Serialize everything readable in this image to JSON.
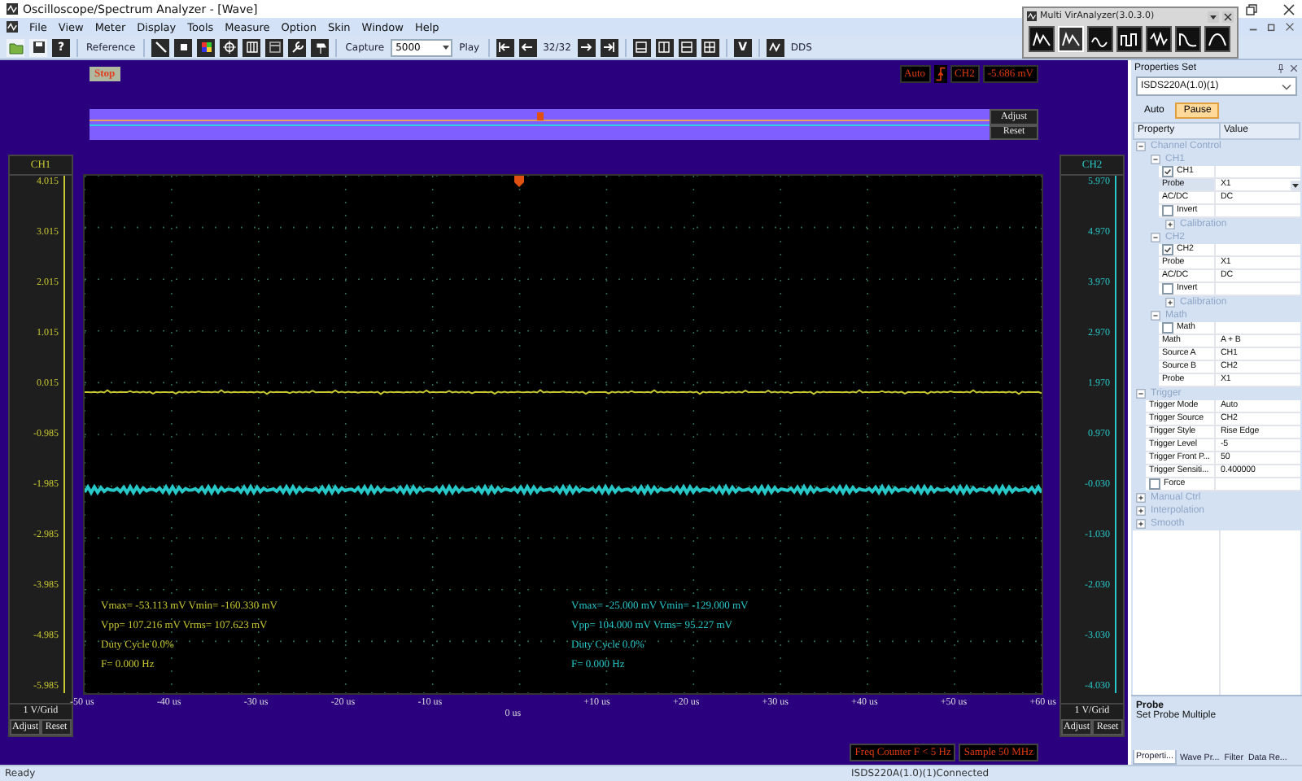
{
  "window": {
    "title": "Oscilloscope/Spectrum Analyzer - [Wave]"
  },
  "menu": [
    "File",
    "View",
    "Meter",
    "Display",
    "Tools",
    "Measure",
    "Option",
    "Skin",
    "Window",
    "Help"
  ],
  "toolbar": {
    "help": "?",
    "reference": "Reference",
    "capture_label": "Capture",
    "capture_value": "5000",
    "play": "Play",
    "frame": "32/32",
    "v": "V",
    "dds": "DDS"
  },
  "analyzer_window": {
    "title": "Multi VirAnalyzer(3.0.3.0)",
    "tools": [
      {
        "selected": false
      },
      {
        "selected": true
      },
      {
        "selected": false
      },
      {
        "selected": false
      },
      {
        "selected": false
      },
      {
        "selected": false
      },
      {
        "selected": false
      }
    ]
  },
  "scope": {
    "stop": "Stop",
    "trigger": {
      "mode": "Auto",
      "source": "CH2",
      "level": "-5.686 mV"
    },
    "overview": {
      "adjust": "Adjust",
      "reset": "Reset"
    },
    "channels": [
      {
        "name": "CH1",
        "color": "#c8c832",
        "ticks": [
          "4.015",
          "3.015",
          "2.015",
          "1.015",
          "0.015",
          "-0.985",
          "-1.985",
          "-2.985",
          "-3.985",
          "-4.985",
          "-5.985"
        ],
        "scale": "1 V/Grid",
        "adjust": "Adjust",
        "reset": "Reset",
        "measurements": [
          "Vmax= -53.113 mV Vmin= -160.330 mV",
          "Vpp= 107.216 mV Vrms= 107.623 mV",
          "Duty Cycle 0.0%",
          "F= 0.000 Hz"
        ]
      },
      {
        "name": "CH2",
        "color": "#28c8c8",
        "ticks": [
          "5.970",
          "4.970",
          "3.970",
          "2.970",
          "1.970",
          "0.970",
          "-0.030",
          "-1.030",
          "-2.030",
          "-3.030",
          "-4.030"
        ],
        "scale": "1 V/Grid",
        "adjust": "Adjust",
        "reset": "Reset",
        "measurements": [
          "Vmax= -25.000 mV Vmin= -129.000 mV",
          "Vpp= 104.000 mV Vrms= 95.227 mV",
          "Duty Cycle 0.0%",
          "F= 0.000 Hz"
        ]
      }
    ],
    "x_ticks": [
      {
        "text": "-50 us",
        "kind": "tick"
      },
      {
        "text": "-40 us",
        "kind": "tick"
      },
      {
        "text": "-30 us",
        "kind": "tick"
      },
      {
        "text": "-20 us",
        "kind": "tick"
      },
      {
        "text": "-10 us",
        "kind": "tick"
      },
      {
        "text": "0 us",
        "kind": "origin"
      },
      {
        "text": "+10 us",
        "kind": "tick"
      },
      {
        "text": "+20 us",
        "kind": "tick"
      },
      {
        "text": "+30 us",
        "kind": "tick"
      },
      {
        "text": "+40 us",
        "kind": "tick"
      },
      {
        "text": "+50 us",
        "kind": "tick"
      },
      {
        "text": "+60 us",
        "kind": "tick"
      }
    ],
    "freq_counter": "Freq Counter F < 5 Hz",
    "sample": "Sample 50 MHz"
  },
  "properties": {
    "title": "Properties Set",
    "device": "ISDS220A(1.0)(1)",
    "tabs": [
      {
        "label": "Auto",
        "selected": false
      },
      {
        "label": "Pause",
        "selected": true
      }
    ],
    "columns": [
      "Property",
      "Value"
    ],
    "tree": [
      {
        "kind": "group",
        "label": "Channel Control",
        "expanded": true,
        "children": [
          {
            "kind": "group",
            "label": "CH1",
            "expanded": true,
            "children": [
              {
                "kind": "check",
                "label": "CH1",
                "checked": true
              },
              {
                "kind": "prop",
                "name": "Probe",
                "value": "X1",
                "selected": true
              },
              {
                "kind": "prop",
                "name": "AC/DC",
                "value": "DC",
                "selected": false
              },
              {
                "kind": "check",
                "label": "Invert",
                "checked": false
              },
              {
                "kind": "group",
                "label": "Calibration",
                "expanded": false
              }
            ]
          },
          {
            "kind": "group",
            "label": "CH2",
            "expanded": true,
            "children": [
              {
                "kind": "check",
                "label": "CH2",
                "checked": true
              },
              {
                "kind": "prop",
                "name": "Probe",
                "value": "X1",
                "selected": false
              },
              {
                "kind": "prop",
                "name": "AC/DC",
                "value": "DC",
                "selected": false
              },
              {
                "kind": "check",
                "label": "Invert",
                "checked": false
              },
              {
                "kind": "group",
                "label": "Calibration",
                "expanded": false
              }
            ]
          },
          {
            "kind": "group",
            "label": "Math",
            "expanded": true,
            "children": [
              {
                "kind": "check",
                "label": "Math",
                "checked": false
              },
              {
                "kind": "prop",
                "name": "Math",
                "value": "A + B",
                "selected": false
              },
              {
                "kind": "prop",
                "name": "Source A",
                "value": "CH1",
                "selected": false
              },
              {
                "kind": "prop",
                "name": "Source B",
                "value": "CH2",
                "selected": false
              },
              {
                "kind": "prop",
                "name": "Probe",
                "value": "X1",
                "selected": false
              }
            ]
          }
        ]
      },
      {
        "kind": "group",
        "label": "Trigger",
        "expanded": true,
        "children": [
          {
            "kind": "prop",
            "name": "Trigger Mode",
            "value": "Auto",
            "selected": false
          },
          {
            "kind": "prop",
            "name": "Trigger Source",
            "value": "CH2",
            "selected": false
          },
          {
            "kind": "prop",
            "name": "Trigger Style",
            "value": "Rise Edge",
            "selected": false
          },
          {
            "kind": "prop",
            "name": "Trigger Level",
            "value": "-5",
            "selected": false
          },
          {
            "kind": "prop",
            "name": "Trigger Front P...",
            "value": "50",
            "selected": false
          },
          {
            "kind": "prop",
            "name": "Trigger Sensiti...",
            "value": "0.400000",
            "selected": false
          },
          {
            "kind": "check",
            "label": "Force",
            "checked": false
          }
        ]
      },
      {
        "kind": "group",
        "label": "Manual Ctrl",
        "expanded": false
      },
      {
        "kind": "group",
        "label": "Interpolation",
        "expanded": false
      },
      {
        "kind": "group",
        "label": "Smooth",
        "expanded": false
      }
    ],
    "description": {
      "title": "Probe",
      "text": "Set Probe Multiple"
    },
    "bottom_tabs": [
      {
        "label": "Properti...",
        "selected": true
      },
      {
        "label": "Wave Pr...",
        "selected": false
      },
      {
        "label": "Filter",
        "selected": false
      },
      {
        "label": "Data Re...",
        "selected": false
      }
    ]
  },
  "status_bar": {
    "left": "Ready",
    "connection": "ISDS220A(1.0)(1)Connected"
  }
}
